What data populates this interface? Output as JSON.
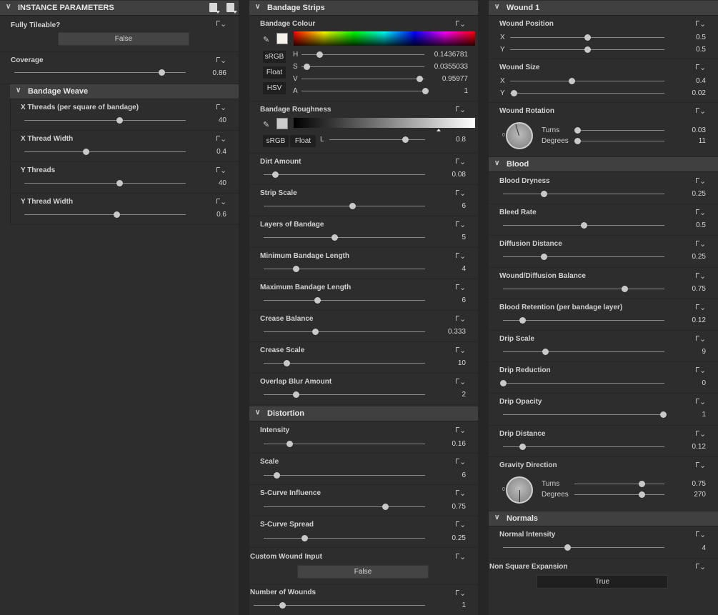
{
  "instance": {
    "title": "INSTANCE PARAMETERS",
    "tileable": {
      "label": "Fully Tileable?",
      "value": "False"
    },
    "coverage": {
      "label": "Coverage",
      "value": "0.86"
    },
    "weave": {
      "title": "Bandage Weave",
      "params": [
        {
          "label": "X Threads (per square of bandage)",
          "value": "40"
        },
        {
          "label": "X Thread Width",
          "value": "0.4"
        },
        {
          "label": "Y Threads",
          "value": "40"
        },
        {
          "label": "Y Thread Width",
          "value": "0.6"
        }
      ]
    }
  },
  "strips": {
    "title": "Bandage Strips",
    "colour": {
      "label": "Bandage Colour",
      "mode_buttons": [
        "sRGB",
        "Float",
        "HSV"
      ],
      "channels": [
        {
          "name": "H",
          "value": "0.1436781"
        },
        {
          "name": "S",
          "value": "0.0355033"
        },
        {
          "name": "V",
          "value": "0.95977"
        },
        {
          "name": "A",
          "value": "1"
        }
      ]
    },
    "roughness": {
      "label": "Bandage Roughness",
      "buttons": [
        "sRGB",
        "Float"
      ],
      "channel": "L",
      "value": "0.8"
    },
    "params": [
      {
        "label": "Dirt Amount",
        "value": "0.08"
      },
      {
        "label": "Strip Scale",
        "value": "6"
      },
      {
        "label": "Layers of Bandage",
        "value": "5"
      },
      {
        "label": "Minimum Bandage Length",
        "value": "4"
      },
      {
        "label": "Maximum Bandage Length",
        "value": "6"
      },
      {
        "label": "Crease Balance",
        "value": "0.333"
      },
      {
        "label": "Crease Scale",
        "value": "10"
      },
      {
        "label": "Overlap Blur Amount",
        "value": "2"
      }
    ]
  },
  "distortion": {
    "title": "Distortion",
    "params": [
      {
        "label": "Intensity",
        "value": "0.16"
      },
      {
        "label": "Scale",
        "value": "6"
      },
      {
        "label": "S-Curve Influence",
        "value": "0.75"
      },
      {
        "label": "S-Curve Spread",
        "value": "0.25"
      }
    ]
  },
  "custom_wound": {
    "label": "Custom Wound Input",
    "value": "False"
  },
  "num_wounds": {
    "label": "Number of Wounds",
    "value": "1"
  },
  "wound": {
    "title": "Wound 1",
    "position": {
      "label": "Wound Position",
      "x": "0.5",
      "y": "0.5"
    },
    "size": {
      "label": "Wound Size",
      "x": "0.4",
      "y": "0.02"
    },
    "rotation": {
      "label": "Wound Rotation",
      "turns_label": "Turns",
      "turns": "0.03",
      "degrees_label": "Degrees",
      "degrees": "11"
    },
    "axis_x": "X",
    "axis_y": "Y",
    "dial_zero": "0"
  },
  "blood": {
    "title": "Blood",
    "params": [
      {
        "label": "Blood Dryness",
        "value": "0.25"
      },
      {
        "label": "Bleed Rate",
        "value": "0.5"
      },
      {
        "label": "Diffusion Distance",
        "value": "0.25"
      },
      {
        "label": "Wound/Diffusion Balance",
        "value": "0.75"
      },
      {
        "label": "Blood Retention (per bandage layer)",
        "value": "0.12"
      },
      {
        "label": "Drip Scale",
        "value": "9"
      },
      {
        "label": "Drip Reduction",
        "value": "0"
      },
      {
        "label": "Drip Opacity",
        "value": "1"
      },
      {
        "label": "Drip Distance",
        "value": "0.12"
      }
    ],
    "gravity": {
      "label": "Gravity Direction",
      "turns_label": "Turns",
      "turns": "0.75",
      "degrees_label": "Degrees",
      "degrees": "270"
    }
  },
  "normals": {
    "title": "Normals",
    "intensity": {
      "label": "Normal Intensity",
      "value": "4"
    },
    "non_square": {
      "label": "Non Square Expansion",
      "value": "True"
    }
  }
}
